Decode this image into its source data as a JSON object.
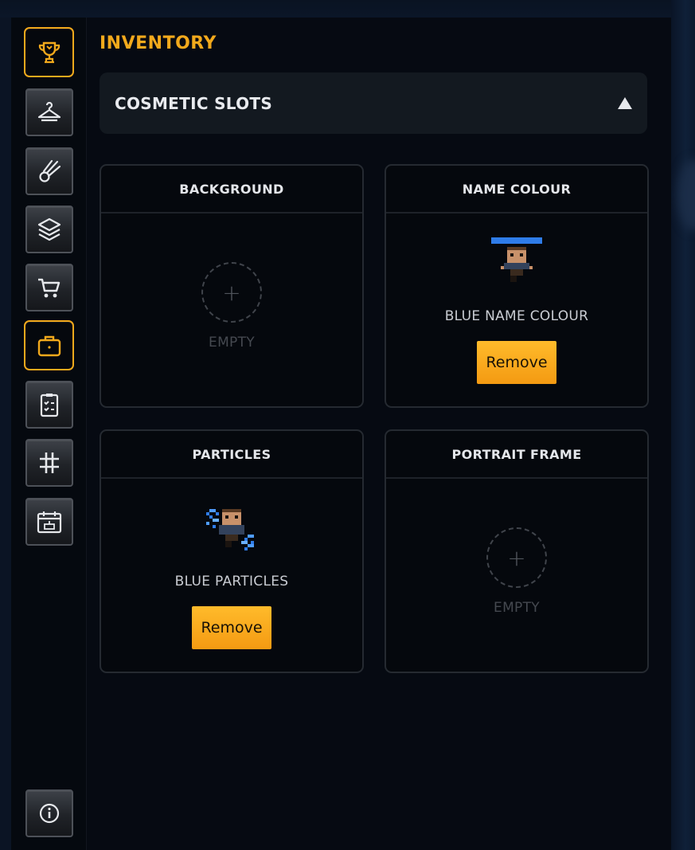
{
  "sidebar": {
    "items": [
      {
        "icon": "trophy-icon",
        "active": true
      },
      {
        "icon": "hanger-icon",
        "active": false
      },
      {
        "icon": "comet-icon",
        "active": false
      },
      {
        "icon": "layers-icon",
        "active": false
      },
      {
        "icon": "cart-icon",
        "active": false
      },
      {
        "icon": "briefcase-icon",
        "active": true
      },
      {
        "icon": "checklist-icon",
        "active": false
      },
      {
        "icon": "hashtag-icon",
        "active": false
      },
      {
        "icon": "calendar-cake-icon",
        "active": false
      }
    ],
    "info_icon": "info-icon"
  },
  "header": {
    "title": "INVENTORY"
  },
  "section": {
    "label": "COSMETIC SLOTS",
    "state": "expanded"
  },
  "slots": [
    {
      "title": "BACKGROUND",
      "status": "EMPTY"
    },
    {
      "title": "NAME COLOUR",
      "item": "BLUE NAME COLOUR",
      "action": "Remove"
    },
    {
      "title": "PARTICLES",
      "item": "BLUE PARTICLES",
      "action": "Remove"
    },
    {
      "title": "PORTRAIT FRAME",
      "status": "EMPTY"
    }
  ],
  "empty_plus": "+",
  "colors": {
    "accent": "#f2a91c",
    "button": "#f9a91c",
    "background": "#060a12",
    "blue": "#2f7ce8"
  }
}
